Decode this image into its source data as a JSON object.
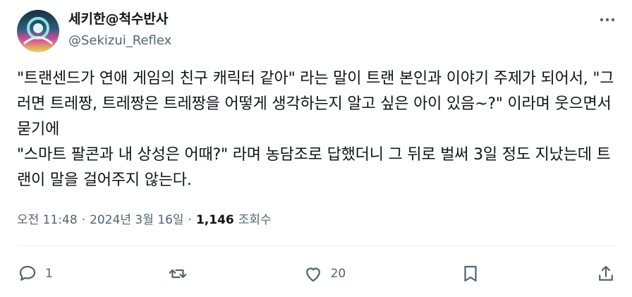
{
  "author": {
    "display_name": "세키한@척수반사",
    "handle": "@Sekizui_Reflex",
    "avatar_icon": "avatar-image"
  },
  "tweet": {
    "text": "\"트랜센드가 연애 게임의 친구 캐릭터 같아\" 라는 말이 트랜 본인과 이야기 주제가 되어서, \"그러면 트레짱, 트레짱은 트레짱을 어떻게 생각하는지 알고 싶은 아이 있음~?\" 이라며 웃으면서 묻기에\n\"스마트 팔콘과 내 상성은 어때?\" 라며 농담조로 답했더니 그 뒤로 벌써 3일 정도 지났는데 트랜이 말을 걸어주지 않는다."
  },
  "meta": {
    "time": "오전 11:48",
    "sep1": "·",
    "date": "2024년 3월 16일",
    "sep2": "·",
    "views_count": "1,146",
    "views_label": "조회수"
  },
  "actions": {
    "reply_count": "1",
    "like_count": "20"
  },
  "colors": {
    "text_primary": "#0f1419",
    "text_secondary": "#536471",
    "divider": "#eff3f4"
  }
}
